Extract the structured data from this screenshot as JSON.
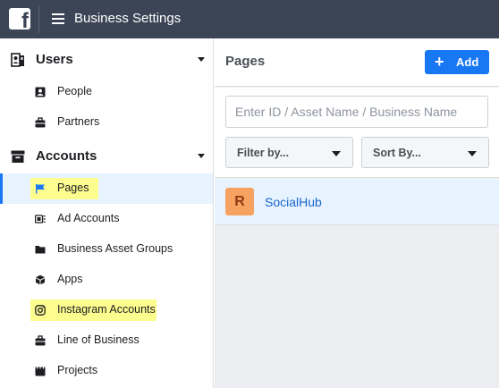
{
  "app": {
    "logo_text": "f",
    "title": "Business Settings"
  },
  "sidebar": {
    "sections": [
      {
        "label": "Users",
        "icon": "users-icon",
        "items": [
          {
            "label": "People",
            "icon": "person-icon"
          },
          {
            "label": "Partners",
            "icon": "briefcase-icon"
          }
        ]
      },
      {
        "label": "Accounts",
        "icon": "archive-box-icon",
        "items": [
          {
            "label": "Pages",
            "icon": "flag-icon",
            "active": true,
            "highlighted": true
          },
          {
            "label": "Ad Accounts",
            "icon": "ad-accounts-icon"
          },
          {
            "label": "Business Asset Groups",
            "icon": "folder-icon"
          },
          {
            "label": "Apps",
            "icon": "cube-icon"
          },
          {
            "label": "Instagram Accounts",
            "icon": "instagram-icon",
            "highlighted": true
          },
          {
            "label": "Line of Business",
            "icon": "briefcase-icon"
          },
          {
            "label": "Projects",
            "icon": "projects-icon"
          }
        ]
      }
    ]
  },
  "main": {
    "title": "Pages",
    "add_button": {
      "icon": "plus",
      "label": "Add"
    },
    "search": {
      "placeholder": "Enter ID / Asset Name / Business Name",
      "value": ""
    },
    "filter": {
      "label": "Filter by..."
    },
    "sort": {
      "label": "Sort By..."
    },
    "pages": [
      {
        "initial": "R",
        "name": "SocialHub",
        "avatar_color": "#f7a261",
        "selected": true
      }
    ]
  },
  "colors": {
    "topbar": "#3c4556",
    "accent": "#1877f2",
    "highlight": "#fdfc8f",
    "selected_row": "#e7f3ff",
    "link": "#1a66cc"
  }
}
